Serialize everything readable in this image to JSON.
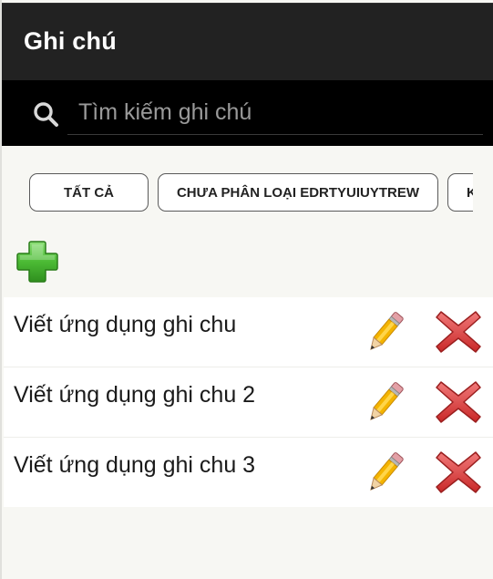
{
  "toolbar": {
    "title": "Ghi chú"
  },
  "search": {
    "placeholder": "Tìm kiếm ghi chú",
    "value": ""
  },
  "categories": {
    "items": [
      {
        "label": "TẤT CẢ"
      },
      {
        "label": "CHƯA PHÂN LOẠI EDRTYUIUYTREW"
      },
      {
        "label": "K"
      }
    ]
  },
  "icons": {
    "add": "plus-icon",
    "edit": "pencil-icon",
    "delete": "x-icon",
    "search": "search-icon"
  },
  "colors": {
    "toolbar_bg": "#222222",
    "search_bg": "#000000",
    "add_green": "#43b02a",
    "delete_red": "#d93535",
    "pencil_yellow": "#f4b400"
  },
  "notes": [
    {
      "title": "Viết ứng dụng ghi chu"
    },
    {
      "title": "Viết ứng dụng ghi chu 2"
    },
    {
      "title": "Viết ứng dụng ghi chu 3"
    }
  ]
}
